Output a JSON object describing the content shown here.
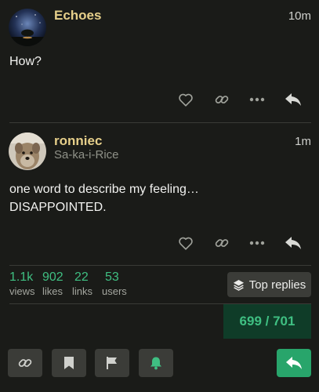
{
  "posts": [
    {
      "username": "Echoes",
      "user_title": "",
      "time": "10m",
      "lines": [
        "How?"
      ]
    },
    {
      "username": "ronniec",
      "user_title": "Sa-ka-i-Rice",
      "time": "1m",
      "lines": [
        "one word to describe my feeling…",
        "DISAPPOINTED."
      ]
    }
  ],
  "topic_stats": {
    "views": {
      "value": "1.1k",
      "label": "views"
    },
    "likes": {
      "value": "902",
      "label": "likes"
    },
    "links": {
      "value": "22",
      "label": "links"
    },
    "users": {
      "value": "53",
      "label": "users"
    }
  },
  "top_replies_label": "Top replies",
  "progress": "699 / 701",
  "icons": {
    "like": "heart-icon",
    "copy_link": "link-icon",
    "more": "ellipsis-icon",
    "reply": "reply-arrow-icon",
    "top_replies": "layers-icon",
    "bookmark": "bookmark-icon",
    "flag": "flag-icon",
    "notifications": "bell-icon"
  },
  "colors": {
    "background": "#1a1b18",
    "username": "#e6cf8a",
    "stat_number": "#3fbf82",
    "primary_button": "#28a56b",
    "notification_bell": "#3fbf82",
    "progress_bg": "#0f3c28"
  }
}
